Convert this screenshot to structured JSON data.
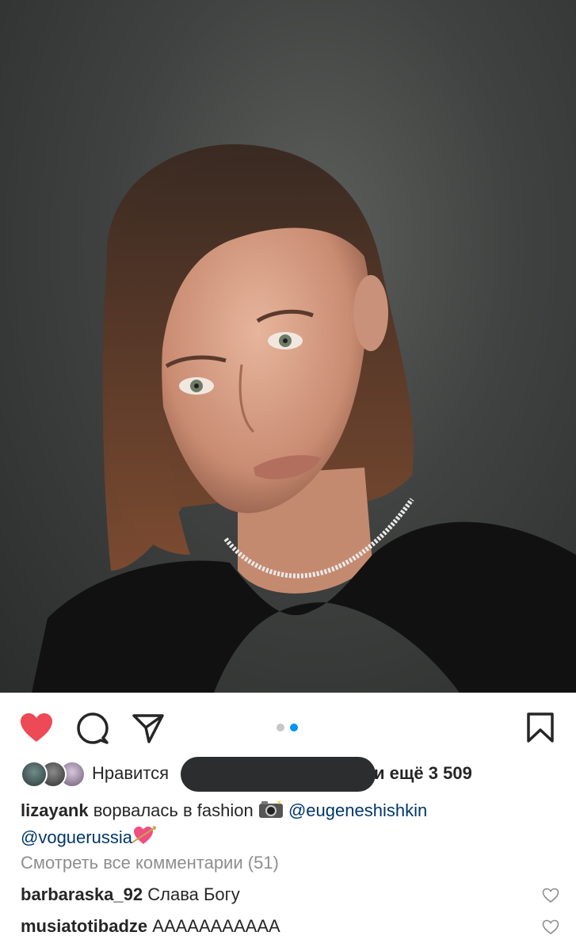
{
  "post": {
    "photo_icon": "portrait-photo",
    "likes": {
      "prefix": "Нравится",
      "suffix": "и ещё 3 509"
    },
    "caption": {
      "username": "lizayank",
      "text": "ворвалась в fashion",
      "emoji_1": "camera-flash-emoji",
      "mention_1": "@eugeneshishkin",
      "mention_2": "@voguerussia",
      "emoji_2": "heart-with-arrow-emoji"
    },
    "view_comments": "Смотреть все комментарии (51)",
    "comments": [
      {
        "username": "barbaraska_92",
        "text": "Слава Богу"
      },
      {
        "username": "musiatotibadze",
        "text": "ААААААААААА"
      }
    ]
  },
  "carousel": {
    "total": 2,
    "active": 2
  },
  "colors": {
    "like_active": "#ed4956",
    "link": "#00376b",
    "muted": "#8e8e8e",
    "accent_dot": "#0095f6"
  }
}
